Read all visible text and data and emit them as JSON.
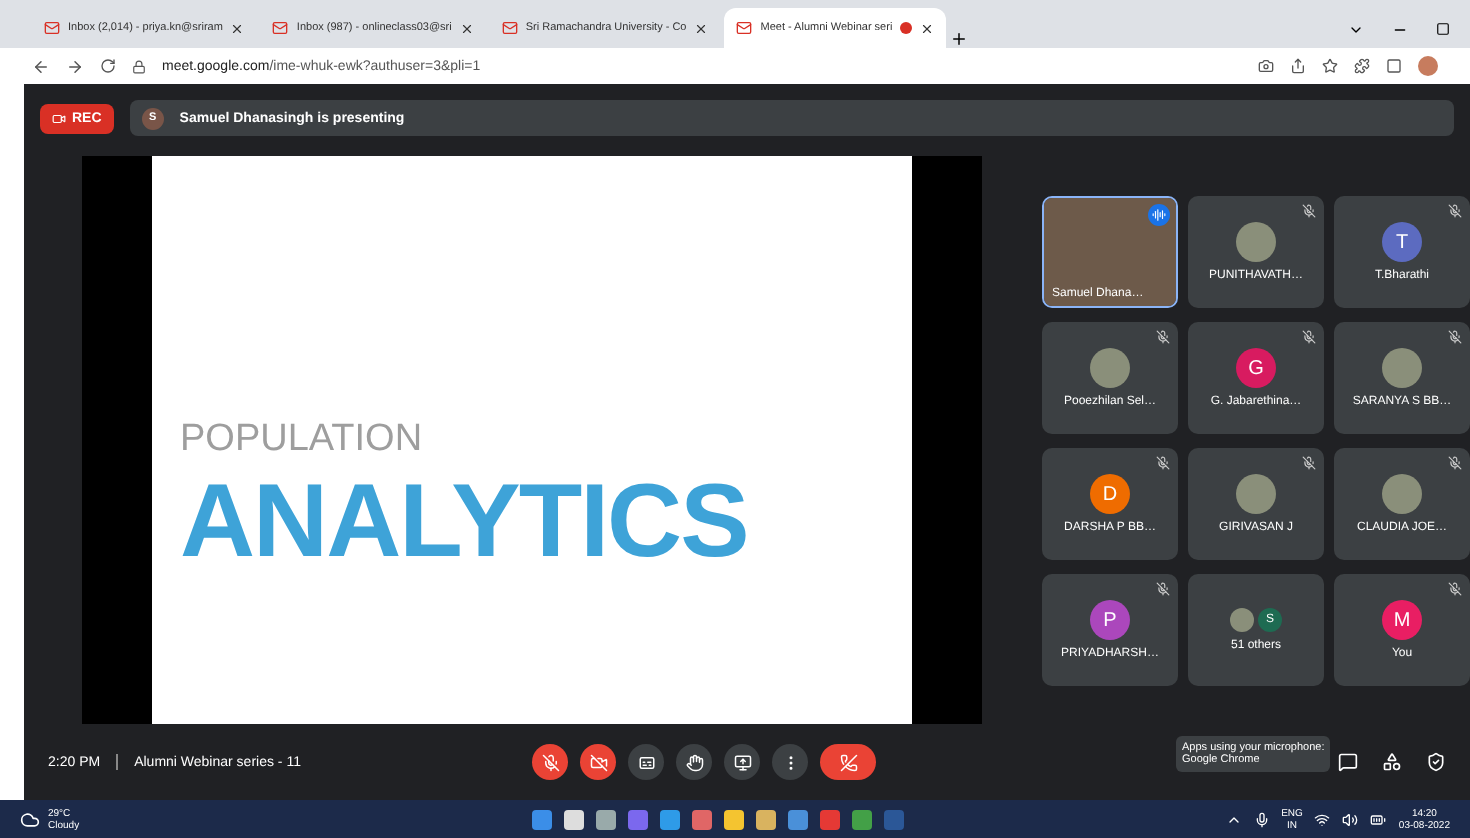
{
  "browser": {
    "tabs": [
      {
        "label": "Inbox (2,014) - priya.kn@sriram",
        "selected": false
      },
      {
        "label": "Inbox (987) - onlineclass03@sri",
        "selected": false
      },
      {
        "label": "Sri Ramachandra University - Co",
        "selected": false
      },
      {
        "label": "Meet - Alumni Webinar seri",
        "selected": true,
        "recording": true
      }
    ],
    "url_host": "meet.google.com",
    "url_path": "/ime-whuk-ewk?authuser=3&pli=1"
  },
  "meet": {
    "rec_label": "REC",
    "presenter_initial": "S",
    "presenter_text": "Samuel Dhanasingh is presenting",
    "slide": {
      "subtitle": "POPULATION",
      "title": "ANALYTICS"
    },
    "tiles": [
      {
        "kind": "video",
        "name": "Samuel Dhana…",
        "muted": false,
        "speaking": true
      },
      {
        "kind": "photo",
        "name": "PUNITHAVATH…",
        "muted": true,
        "speaking": false
      },
      {
        "kind": "letter",
        "letter": "T",
        "color": "#5c6bc0",
        "name": "T.Bharathi",
        "muted": true,
        "speaking": false
      },
      {
        "kind": "photo",
        "name": "Pooezhilan Sel…",
        "muted": true,
        "speaking": false
      },
      {
        "kind": "letter",
        "letter": "G",
        "color": "#d81b60",
        "name": "G. Jabarethina…",
        "muted": true,
        "speaking": false
      },
      {
        "kind": "photo",
        "name": "SARANYA S BB…",
        "muted": true,
        "speaking": false
      },
      {
        "kind": "letter",
        "letter": "D",
        "color": "#ef6c00",
        "name": "DARSHA P BB…",
        "muted": true,
        "speaking": false
      },
      {
        "kind": "photo",
        "name": "GIRIVASAN J",
        "muted": true,
        "speaking": false
      },
      {
        "kind": "photo",
        "name": "CLAUDIA JOE…",
        "muted": true,
        "speaking": false
      },
      {
        "kind": "letter",
        "letter": "P",
        "color": "#ab47bc",
        "name": "PRIYADHARSH…",
        "muted": true,
        "speaking": false
      },
      {
        "kind": "others",
        "letter": "S",
        "color": "#1e6b52",
        "name": "51 others",
        "muted": false,
        "speaking": false
      },
      {
        "kind": "letter",
        "letter": "M",
        "color": "#e91e63",
        "name": "You",
        "muted": true,
        "speaking": false
      }
    ],
    "time": "2:20 PM",
    "meeting_name": "Alumni Webinar series - 11",
    "mic_on": false,
    "camera_on": false,
    "mic_tooltip": "Apps using your microphone:\nGoogle Chrome"
  },
  "taskbar": {
    "temperature": "29°C",
    "weather": "Cloudy",
    "language": "ENG",
    "region": "IN",
    "clock": "14:20",
    "date": "03-08-2022"
  }
}
